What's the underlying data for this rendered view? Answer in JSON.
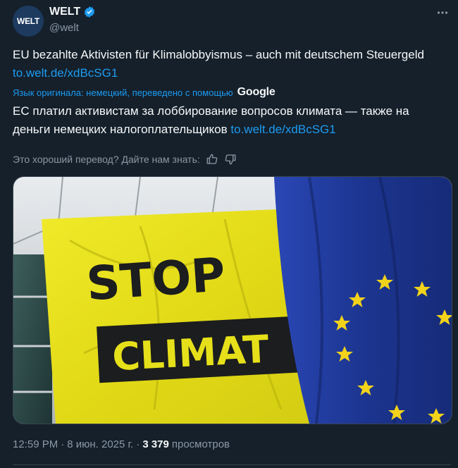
{
  "author": {
    "avatar_text": "WELT",
    "display_name": "WELT",
    "handle": "@welt",
    "verified": true
  },
  "post": {
    "original_text": "EU bezahlte Aktivisten für Klimalobbyismus – auch mit deutschem Steuergeld",
    "original_link": "to.welt.de/xdBcSG1",
    "translation_note": "Язык оригинала: немецкий, переведено с помощью",
    "translation_provider": "Google",
    "translated_text": "ЕС платил активистам за лоббирование вопросов климата — также на деньги немецких налогоплательщиков",
    "translated_link": "to.welt.de/xdBcSG1",
    "feedback_prompt": "Это хороший перевод? Дайте нам знать:"
  },
  "media": {
    "banner_word_1": "STOP",
    "banner_word_2": "CLIMAT"
  },
  "meta": {
    "time": "12:59 PM",
    "separator": "·",
    "date": "8 июн. 2025 г.",
    "separator2": "·",
    "views_count": "3 379",
    "views_label": "просмотров"
  },
  "colors": {
    "background": "#15202b",
    "link": "#1d9bf0",
    "muted": "#8b98a5",
    "banner_yellow": "#e6e01a",
    "eu_blue": "#1f3a9a",
    "eu_star": "#f2d21a"
  }
}
